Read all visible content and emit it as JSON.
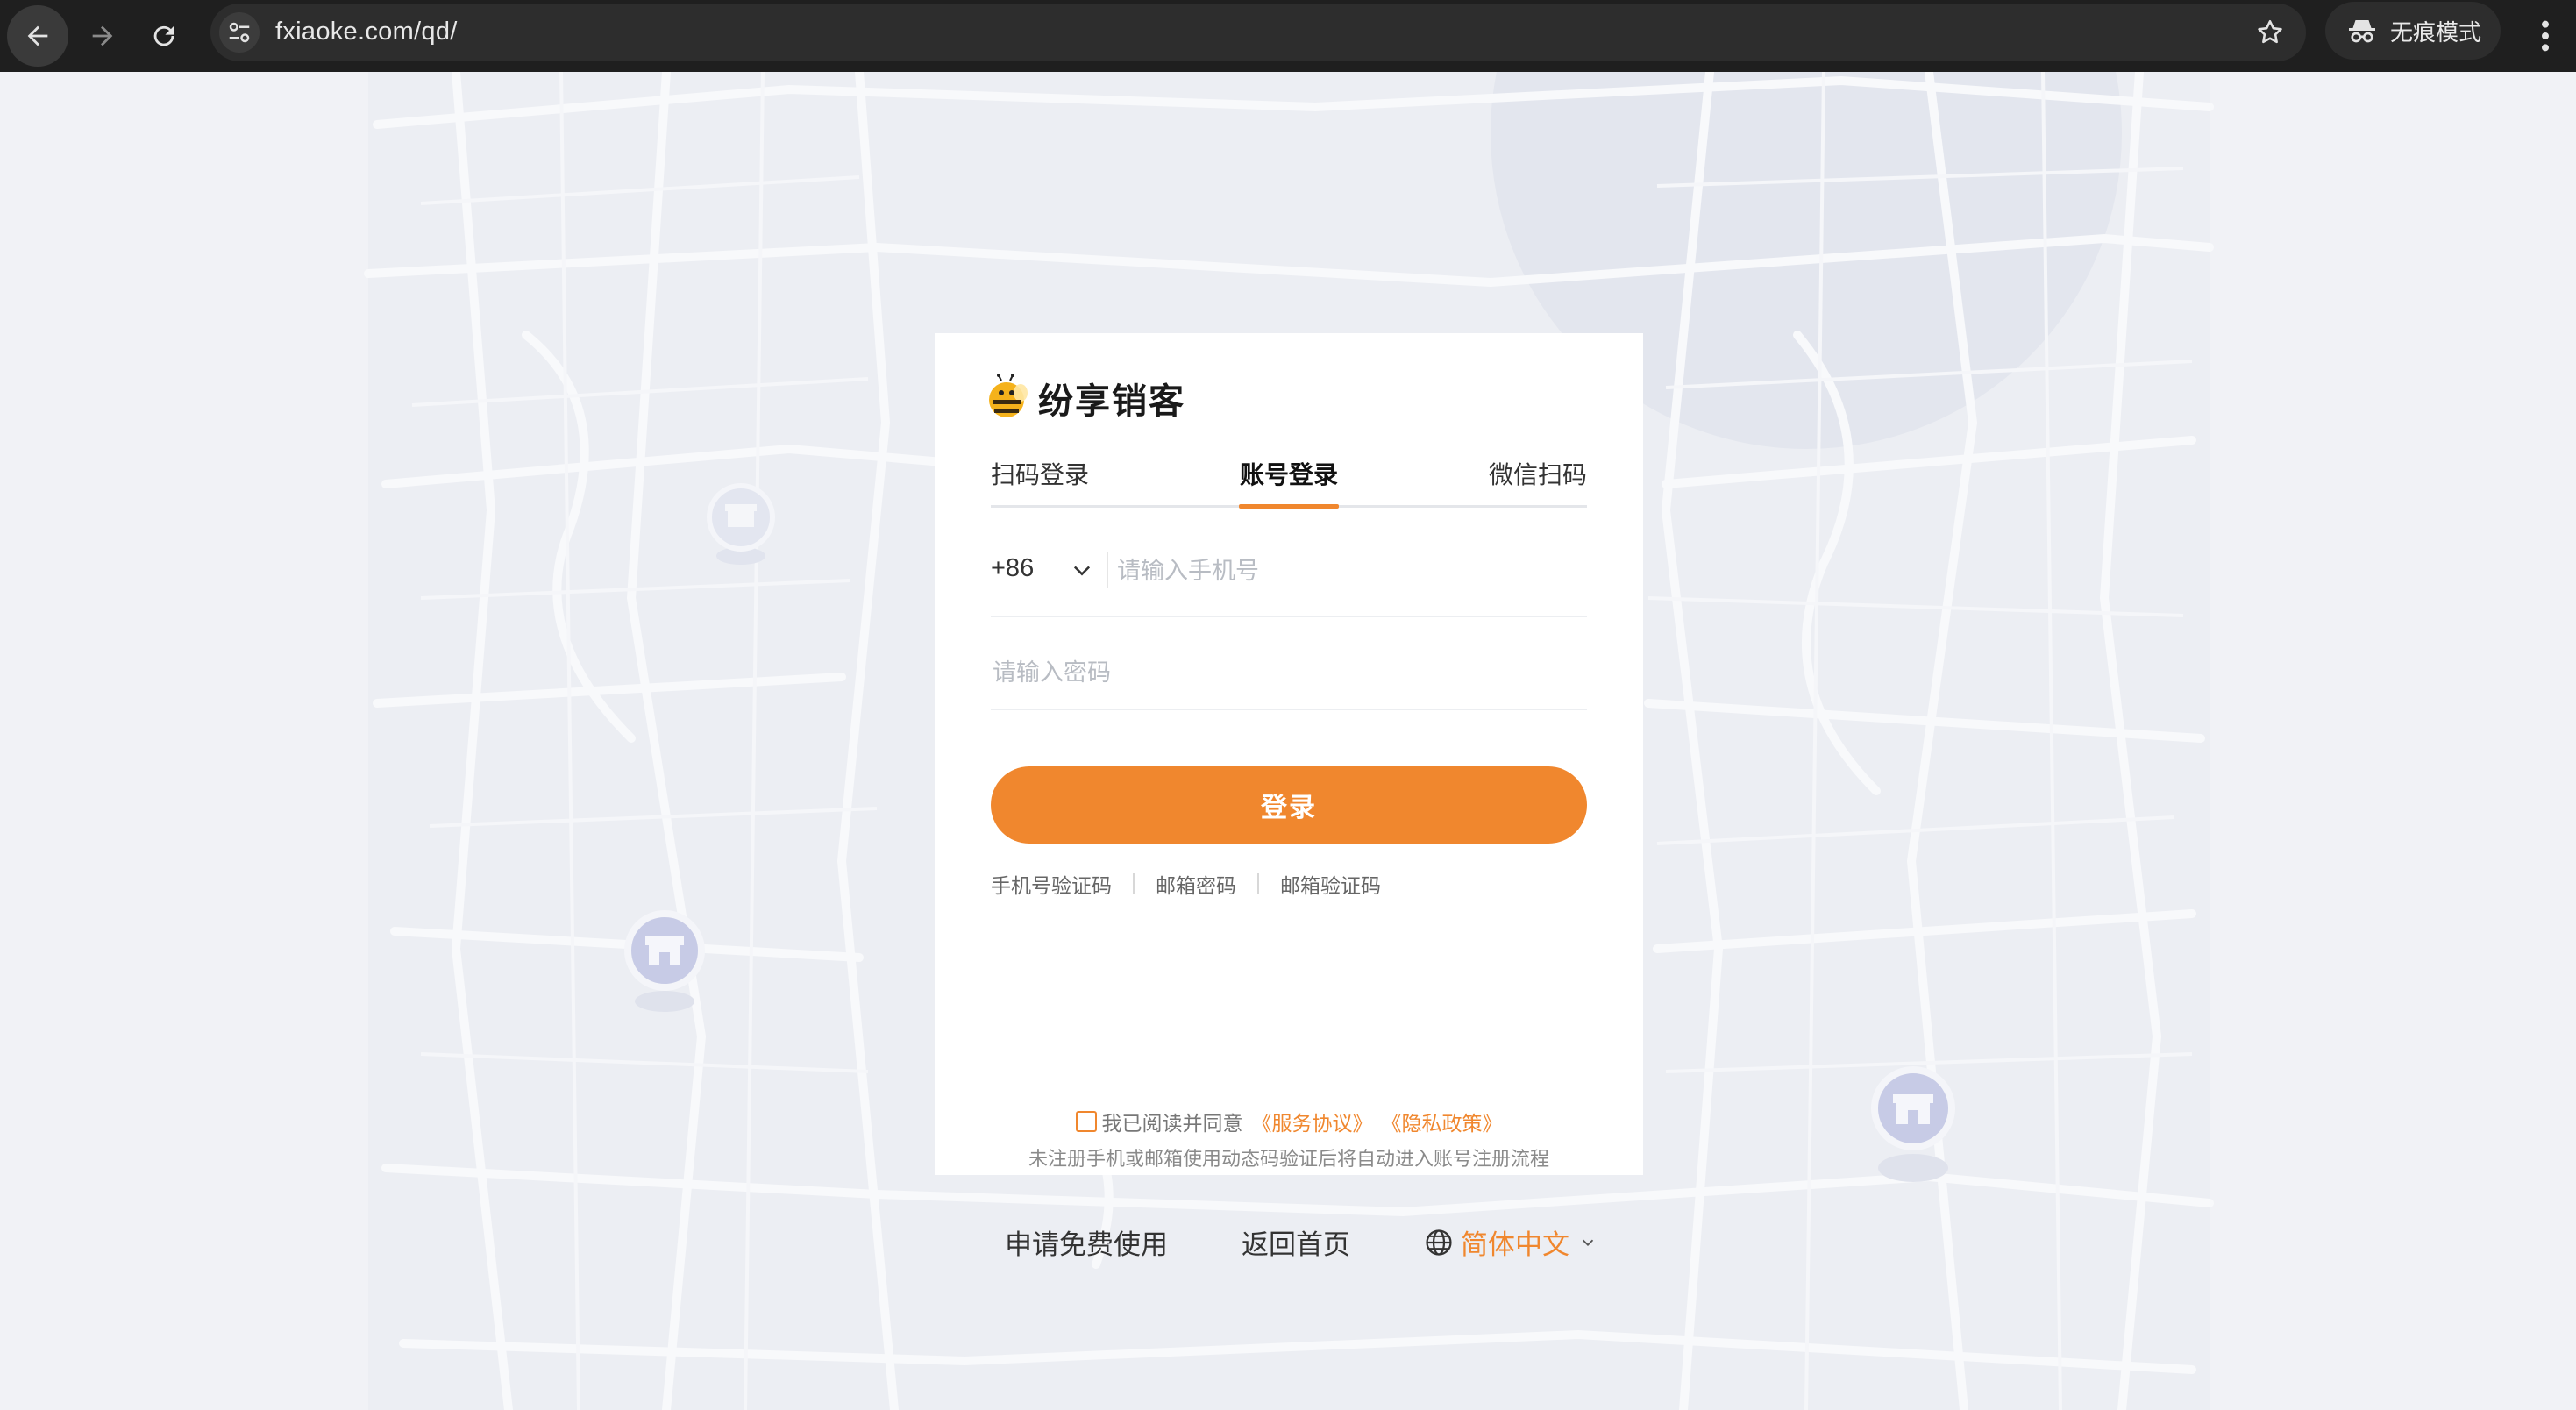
{
  "browser": {
    "url": "fxiaoke.com/qd/",
    "incognito_label": "无痕模式"
  },
  "brand": {
    "name": "纷享销客",
    "accent_color": "#f0872e"
  },
  "login": {
    "tabs": [
      {
        "label": "扫码登录",
        "active": false
      },
      {
        "label": "账号登录",
        "active": true
      },
      {
        "label": "微信扫码",
        "active": false
      }
    ],
    "country_code": "+86",
    "phone_placeholder": "请输入手机号",
    "password_placeholder": "请输入密码",
    "submit_label": "登录",
    "alt_methods": [
      "手机号验证码",
      "邮箱密码",
      "邮箱验证码"
    ],
    "agreement": {
      "prefix": "我已阅读并同意",
      "service_terms": "《服务协议》",
      "privacy_policy": "《隐私政策》",
      "checked": false,
      "note": "未注册手机或邮箱使用动态码验证后将自动进入账号注册流程"
    }
  },
  "footer": {
    "apply_label": "申请免费使用",
    "home_label": "返回首页",
    "language": "简体中文"
  },
  "icons": [
    "back-arrow-icon",
    "forward-arrow-icon",
    "reload-icon",
    "site-settings-icon",
    "star-icon",
    "incognito-icon",
    "more-vert-icon",
    "logo-bee-icon",
    "chevron-down-icon",
    "globe-icon",
    "store-pin-icon"
  ]
}
